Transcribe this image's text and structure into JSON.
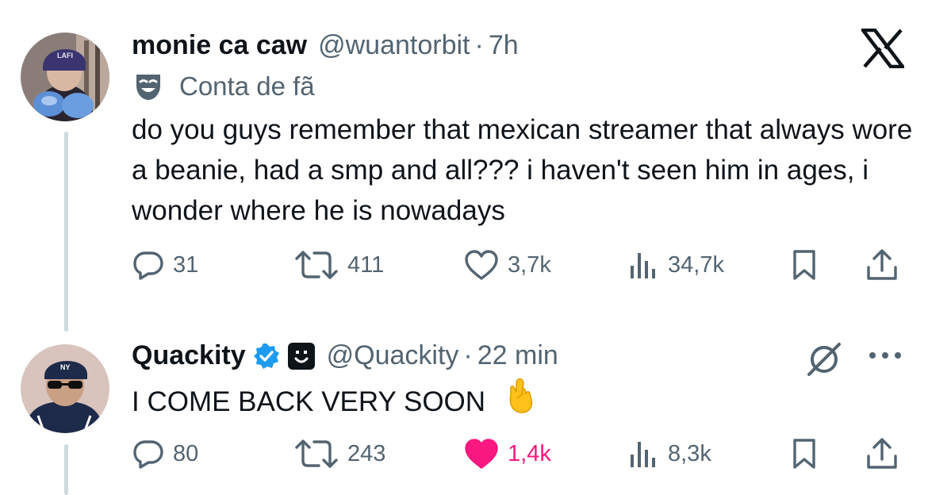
{
  "tweet1": {
    "display_name": "monie ca caw",
    "handle": "@wuantorbit",
    "dot": "·",
    "time": "7h",
    "label": "Conta de fã",
    "text": "do you guys remember that mexican streamer that always wore a beanie, had a smp and all??? i haven't seen him in ages, i wonder where he is nowadays",
    "replies": "31",
    "reposts": "411",
    "likes": "3,7k",
    "views": "34,7k",
    "liked": false
  },
  "tweet2": {
    "display_name": "Quackity",
    "handle": "@Quackity",
    "dot": "·",
    "time": "22 min",
    "text": "I COME BACK VERY SOON",
    "emoji": "crossed-fingers",
    "replies": "80",
    "reposts": "243",
    "likes": "1,4k",
    "views": "8,3k",
    "liked": true
  },
  "colors": {
    "text": "#0f1419",
    "secondary": "#536471",
    "verified": "#1d9bf0",
    "like_active": "#f91880",
    "thread_line": "#cfd9de"
  },
  "icons": {
    "reply": "reply-icon",
    "repost": "repost-icon",
    "like": "heart-icon",
    "views": "views-icon",
    "bookmark": "bookmark-icon",
    "share": "share-icon",
    "logo": "x-logo-icon",
    "grok": "grok-icon",
    "more": "more-icon"
  }
}
